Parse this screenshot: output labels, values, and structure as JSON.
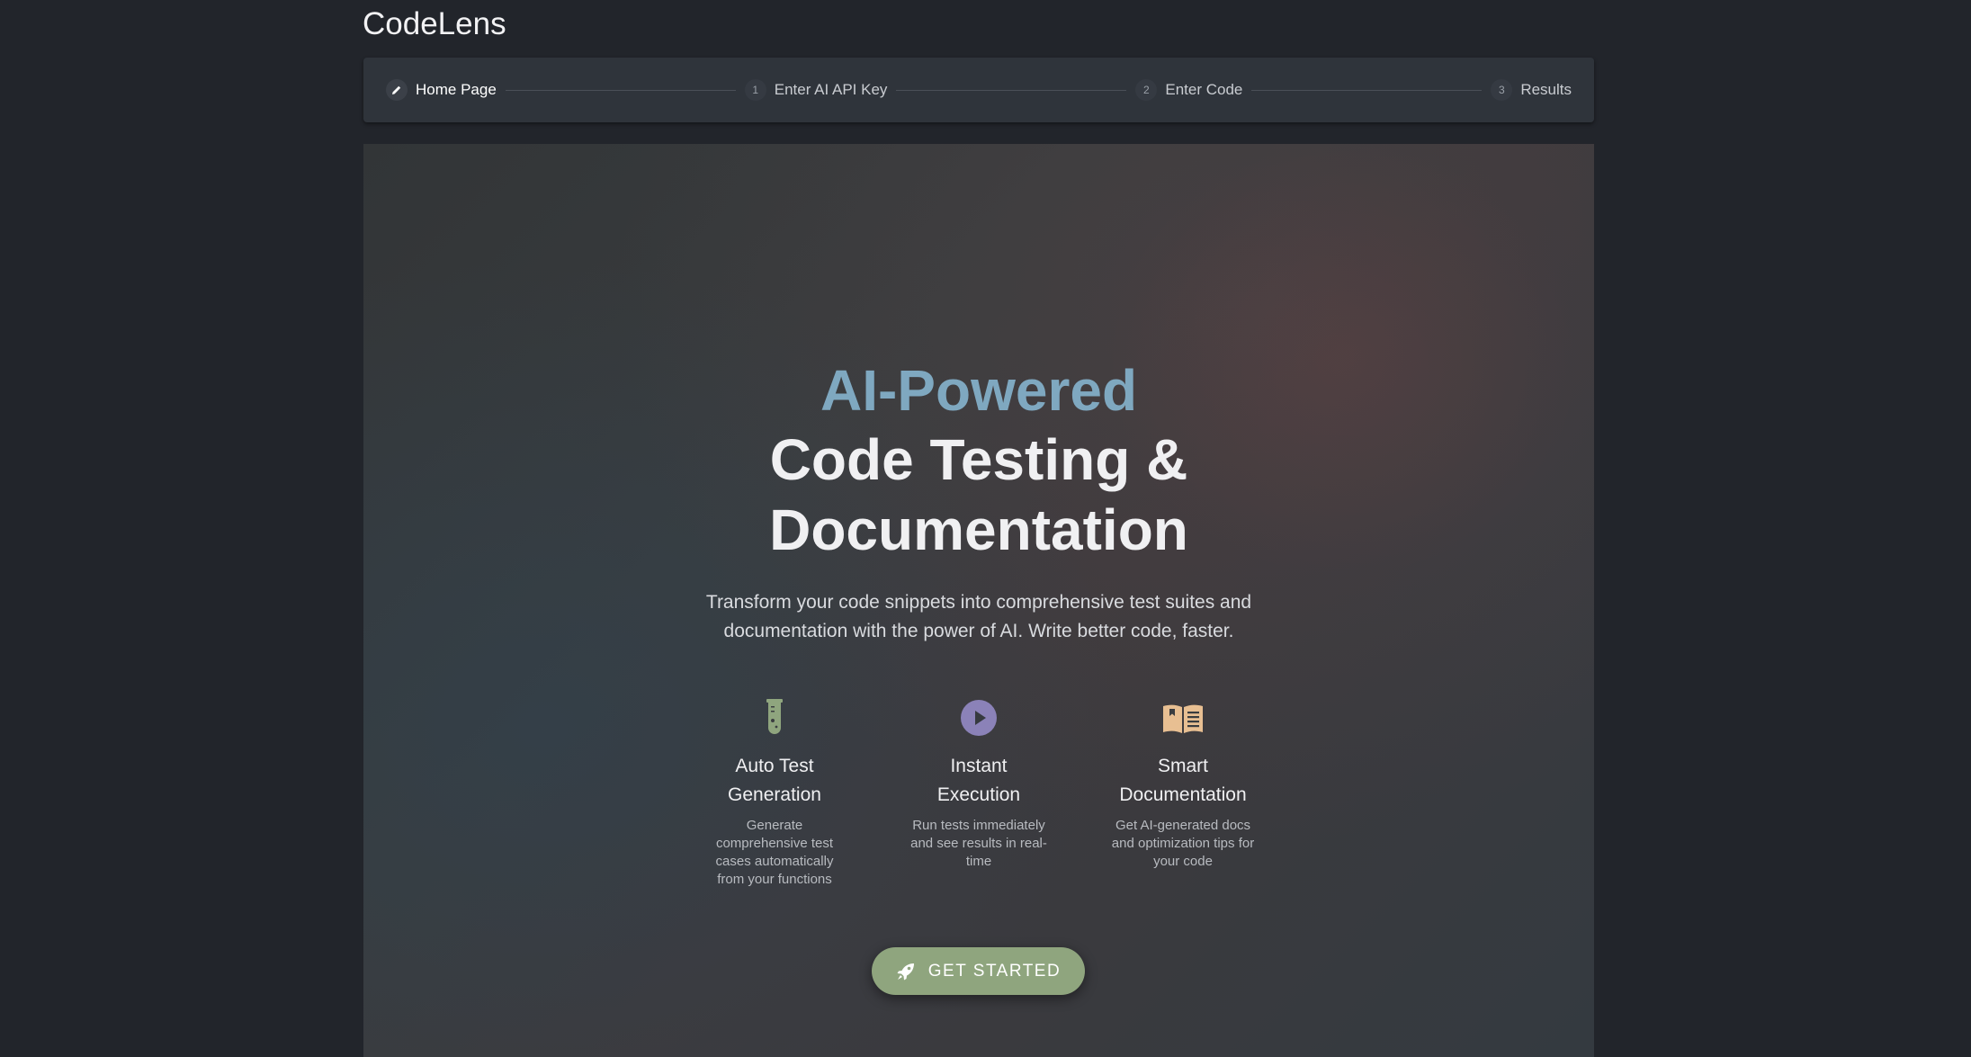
{
  "app": {
    "title": "CodeLens"
  },
  "stepper": {
    "steps": [
      {
        "marker": "",
        "label": "Home Page",
        "active": true,
        "icon": "pencil-icon"
      },
      {
        "marker": "1",
        "label": "Enter AI API Key",
        "active": false
      },
      {
        "marker": "2",
        "label": "Enter Code",
        "active": false
      },
      {
        "marker": "3",
        "label": "Results",
        "active": false
      }
    ]
  },
  "hero": {
    "headline_accent": "AI-Powered",
    "headline_line1": "Code Testing &",
    "headline_line2": "Documentation",
    "subtitle": "Transform your code snippets into comprehensive test suites and documentation with the power of AI. Write better code, faster."
  },
  "features": [
    {
      "icon": "test-tube-icon",
      "icon_color": "#8fa57e",
      "title_line1": "Auto Test",
      "title_line2": "Generation",
      "description": "Generate comprehensive test cases automatically from your functions"
    },
    {
      "icon": "play-circle-icon",
      "icon_color": "#8b82b8",
      "title_line1": "Instant",
      "title_line2": "Execution",
      "description": "Run tests immediately and see results in real-time"
    },
    {
      "icon": "book-icon",
      "icon_color": "#e8bf92",
      "title_line1": "Smart",
      "title_line2": "Documentation",
      "description": "Get AI-generated docs and optimization tips for your code"
    }
  ],
  "cta": {
    "label": "GET STARTED",
    "icon": "rocket-icon",
    "color": "#8fa57e"
  }
}
